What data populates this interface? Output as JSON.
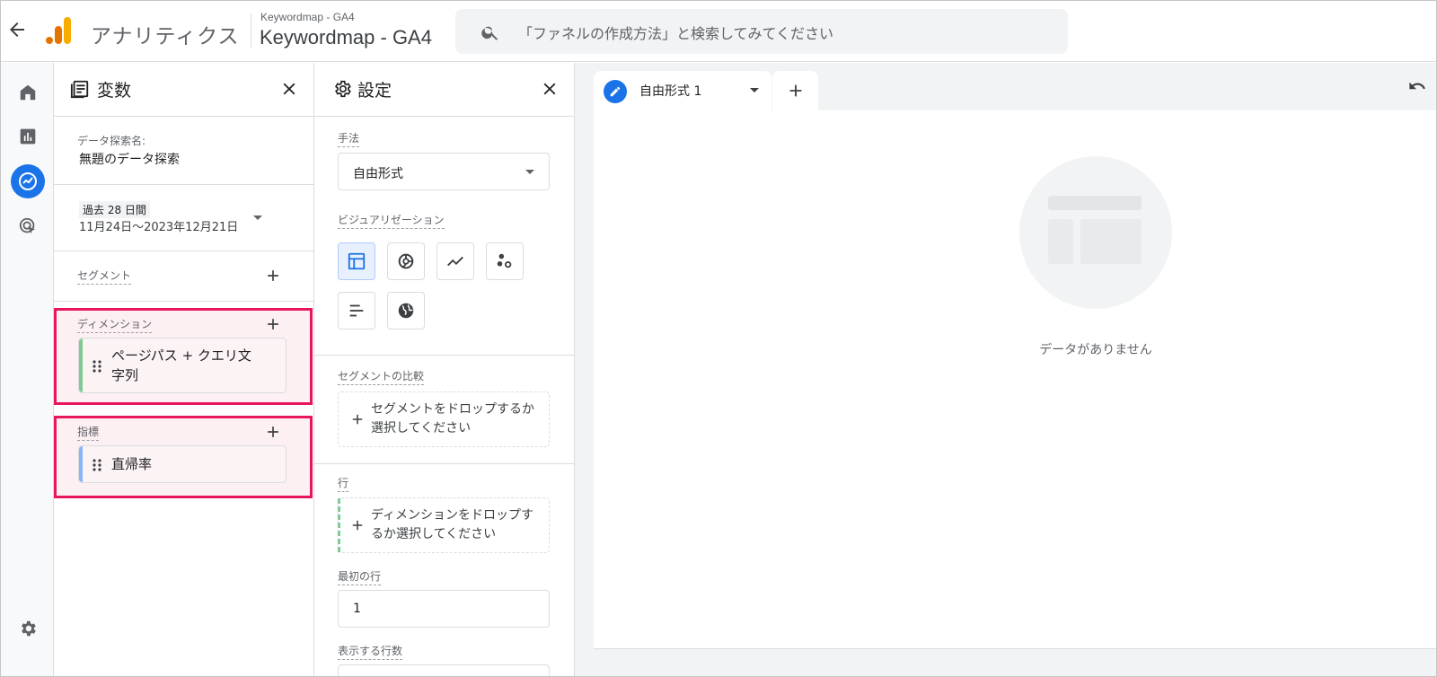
{
  "topbar": {
    "app_title": "アナリティクス",
    "account_small": "Keywordmap - GA4",
    "account_big": "Keywordmap - GA4",
    "search_placeholder": "「ファネルの作成方法」と検索してみてください"
  },
  "colors": {
    "accent": "#1a73e8",
    "highlight_border": "#e8175d",
    "dimension_bar": "#81c995",
    "metric_bar": "#8ab4f8",
    "row_drop_bar": "#81c995"
  },
  "variables_panel": {
    "title": "変数",
    "exploration_label": "データ探索名:",
    "exploration_name": "無題のデータ探索",
    "date_badge": "過去 28 日間",
    "date_range": "11月24日～2023年12月21日",
    "segment_label": "セグメント",
    "dimension_label": "ディメンション",
    "dimension_chip": "ページパス + クエリ文字列",
    "metric_label": "指標",
    "metric_chip": "直帰率"
  },
  "settings_panel": {
    "title": "設定",
    "technique_label": "手法",
    "technique_value": "自由形式",
    "visualization_label": "ビジュアリゼーション",
    "visualizations": [
      "table-icon",
      "donut-chart-icon",
      "line-chart-icon",
      "scatter-plot-icon",
      "bar-chart-icon",
      "globe-icon"
    ],
    "selected_visualization": "table-icon",
    "segment_compare_label": "セグメントの比較",
    "segment_drop_text": "セグメントをドロップするか選択してください",
    "rows_label": "行",
    "rows_drop_text": "ディメンションをドロップするか選択してください",
    "first_row_label": "最初の行",
    "first_row_value": "1",
    "rows_to_show_label": "表示する行数"
  },
  "canvas": {
    "tab_label": "自由形式 1",
    "empty_text": "データがありません"
  }
}
